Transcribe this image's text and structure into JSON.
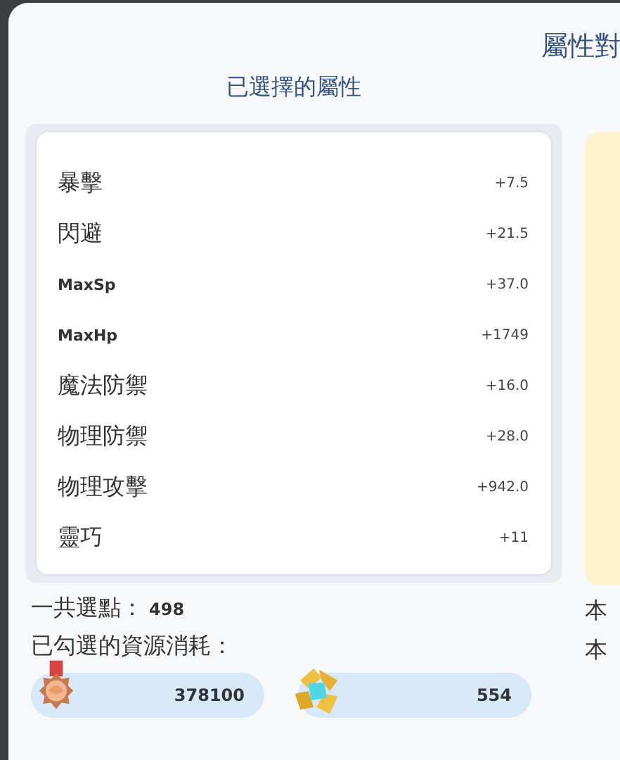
{
  "dialog": {
    "title": "屬性對"
  },
  "selected_section": {
    "heading": "已選擇的屬性",
    "attributes": [
      {
        "name": "暴擊",
        "value": "+7.5",
        "kind": "cjk"
      },
      {
        "name": "閃避",
        "value": "+21.5",
        "kind": "cjk"
      },
      {
        "name": "MaxSp",
        "value": "+37.0",
        "kind": "latin"
      },
      {
        "name": "MaxHp",
        "value": "+1749",
        "kind": "latin"
      },
      {
        "name": "魔法防禦",
        "value": "+16.0",
        "kind": "cjk"
      },
      {
        "name": "物理防禦",
        "value": "+28.0",
        "kind": "cjk"
      },
      {
        "name": "物理攻擊",
        "value": "+942.0",
        "kind": "cjk"
      },
      {
        "name": "靈巧",
        "value": "+11",
        "kind": "cjk"
      }
    ],
    "total_points_label": "一共選點：",
    "total_points": "498",
    "cost_label": "已勾選的資源消耗：",
    "costs": [
      {
        "kind": "medal",
        "amount": "378100"
      },
      {
        "kind": "crystal",
        "amount": "554"
      }
    ]
  },
  "compare_section": {
    "lines": [
      "本",
      "本"
    ]
  }
}
